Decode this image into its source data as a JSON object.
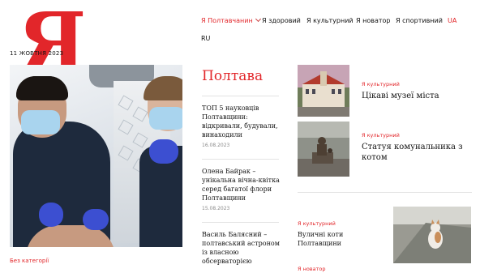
{
  "logo": {
    "text": "Я"
  },
  "date": "11 ЖОВТНЯ 2023",
  "nav": {
    "items": [
      {
        "label": "Я Полтавчанин",
        "active": true,
        "has_dropdown": true
      },
      {
        "label": "Я здоровий"
      },
      {
        "label": "Я культурний"
      },
      {
        "label": "Я новатор"
      },
      {
        "label": "Я спортивний"
      },
      {
        "label": "UA",
        "active": true
      },
      {
        "label": "RU"
      }
    ]
  },
  "hero": {
    "category": "Без категорії"
  },
  "section": {
    "title": "Полтава"
  },
  "mid_articles": [
    {
      "title": "ТОП 5 науковців Полтавщини: відкривали, будували, винаходили",
      "date": "16.08.2023"
    },
    {
      "title": "Олена Байрак – унікальна вічна-квітка серед багатої флори Полтавщини",
      "date": "15.08.2023"
    },
    {
      "title": "Василь Балясний – полтавський астроном із власною обсерваторією",
      "date": ""
    }
  ],
  "right_articles": [
    {
      "category": "Я культурний",
      "title": "Цікаві музеї міста"
    },
    {
      "category": "Я культурний",
      "title": "Статуя комунальника з котом"
    },
    {
      "category": "Я культурний",
      "title": "Вуличні коти Полтавщини"
    },
    {
      "category": "Я новатор",
      "title": ""
    }
  ],
  "colors": {
    "accent": "#e2262a",
    "text": "#111111",
    "muted": "#8a8a8a"
  }
}
